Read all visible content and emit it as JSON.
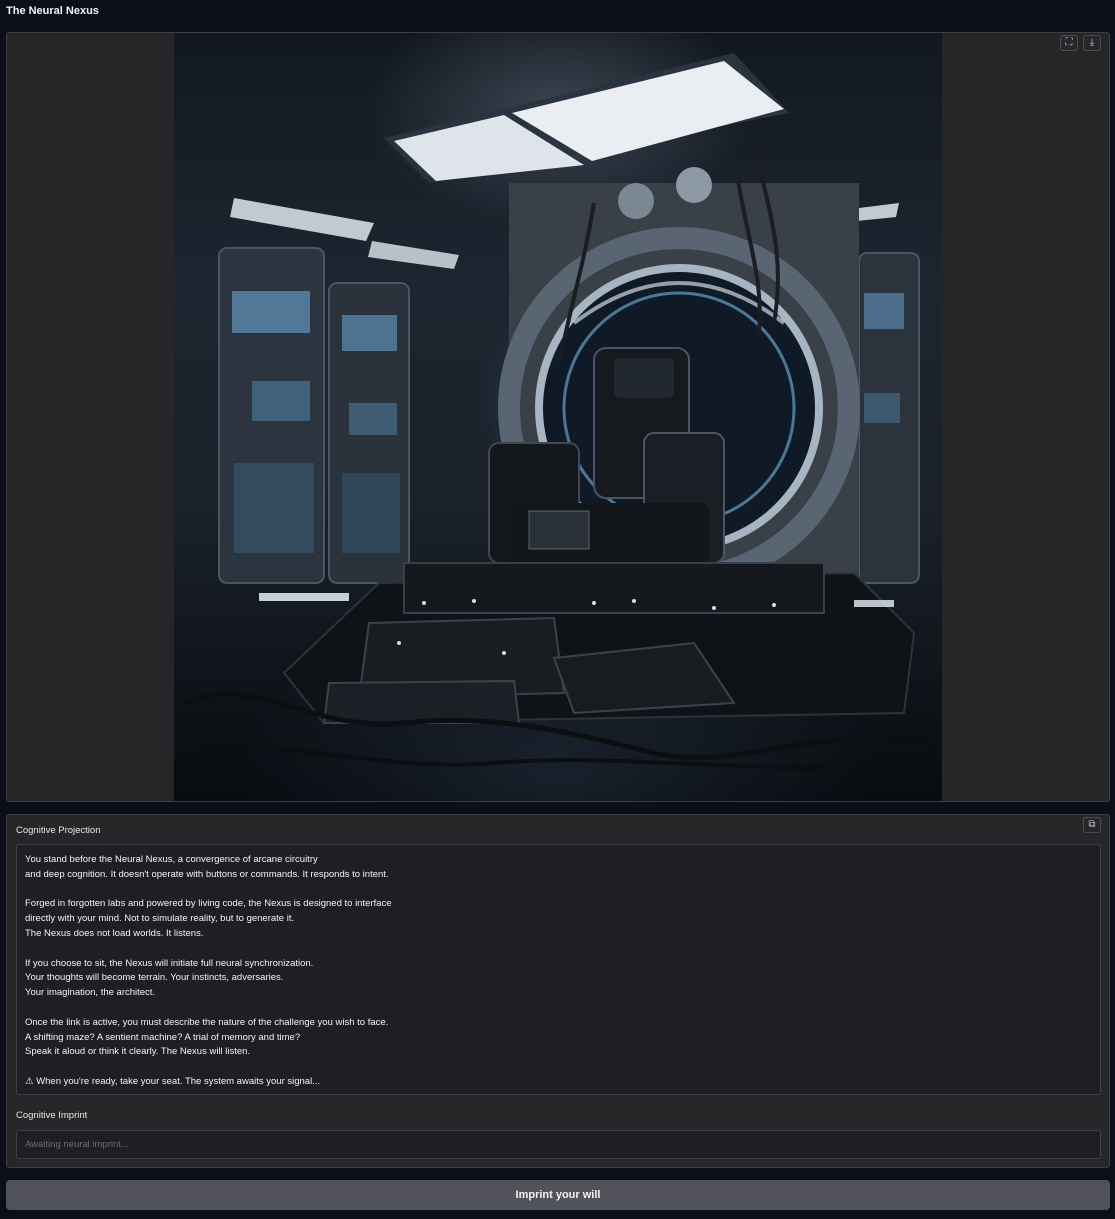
{
  "app": {
    "title": "The Neural Nexus"
  },
  "image_panel": {
    "image_alt": "Futuristic neural interface throne chair in a dark sci-fi chamber",
    "fullscreen_icon": "fullscreen-icon",
    "download_icon": "download-icon"
  },
  "projection": {
    "label": "Cognitive Projection",
    "copy_icon": "copy-icon",
    "text": "You stand before the Neural Nexus, a convergence of arcane circuitry\nand deep cognition. It doesn't operate with buttons or commands. It responds to intent.\n\nForged in forgotten labs and powered by living code, the Nexus is designed to interface\ndirectly with your mind. Not to simulate reality, but to generate it.\nThe Nexus does not load worlds. It listens.\n\nIf you choose to sit, the Nexus will initiate full neural synchronization.\nYour thoughts will become terrain. Your instincts, adversaries.\nYour imagination, the architect.\n\nOnce the link is active, you must describe the nature of the challenge you wish to face.\nA shifting maze? A sentient machine? A trial of memory and time?\nSpeak it aloud or think it clearly. The Nexus will listen.\n\n⚠ When you're ready, take your seat. The system awaits your signal..."
  },
  "imprint": {
    "label": "Cognitive Imprint",
    "placeholder": "Awaiting neural imprint...",
    "value": ""
  },
  "submit": {
    "label": "Imprint your will"
  },
  "colors": {
    "background": "#0b0f19",
    "panel": "#27272a",
    "button": "#52525b"
  }
}
